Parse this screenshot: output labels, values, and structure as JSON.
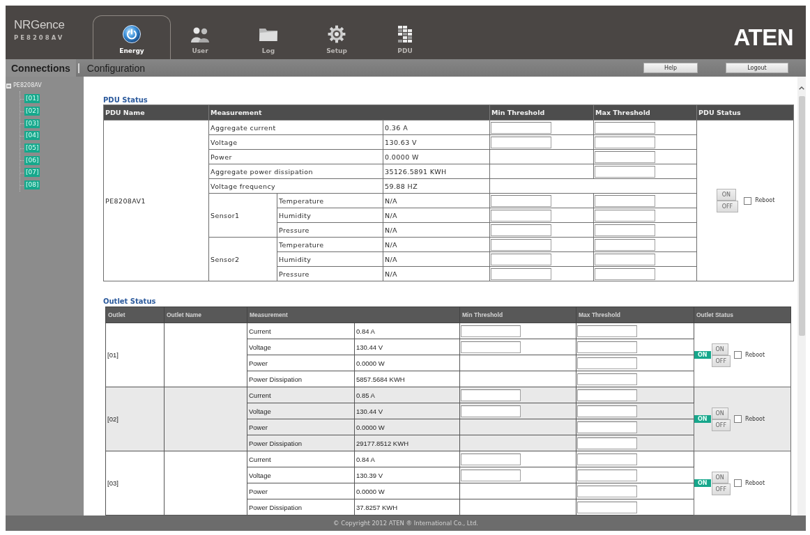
{
  "header": {
    "product_logo": {
      "brand": "NRGence",
      "model": "PE8208AV"
    },
    "tabs": [
      {
        "label": "Energy",
        "selected": true
      },
      {
        "label": "User",
        "selected": false
      },
      {
        "label": "Log",
        "selected": false
      },
      {
        "label": "Setup",
        "selected": false
      },
      {
        "label": "PDU",
        "selected": false
      }
    ],
    "vendor_logo": "ATEN"
  },
  "subnav": {
    "links": [
      {
        "label": "Connections",
        "selected": true
      },
      {
        "label": "Configuration",
        "selected": false
      }
    ],
    "buttons": [
      "Help",
      "Logout"
    ]
  },
  "sidebar": {
    "tree": {
      "label": "PE8208AV",
      "expanded": true,
      "children": [
        {
          "label": "[01]"
        },
        {
          "label": "[02]"
        },
        {
          "label": "[03]"
        },
        {
          "label": "[04]"
        },
        {
          "label": "[05]"
        },
        {
          "label": "[06]"
        },
        {
          "label": "[07]"
        },
        {
          "label": "[08]"
        }
      ]
    }
  },
  "pdu_status": {
    "title": "PDU Status",
    "columns": [
      "PDU Name",
      "Measurement",
      "Min Threshold",
      "Max Threshold",
      "PDU Status"
    ],
    "pdu_name": "PE8208AV1",
    "measurements": [
      {
        "label": "Aggregate current",
        "value": "0.36 A",
        "min_field": true,
        "max_field": true
      },
      {
        "label": "Voltage",
        "value": "130.63 V",
        "min_field": true,
        "max_field": true
      },
      {
        "label": "Power",
        "value": "0.0000 W",
        "min_field": false,
        "max_field": true
      },
      {
        "label": "Aggregate power dissipation",
        "value": "35126.5891 KWH",
        "min_field": false,
        "max_field": true
      },
      {
        "label": "Voltage frequency",
        "value": "59.88 HZ",
        "min_field": false,
        "max_field": false
      }
    ],
    "sensors": [
      {
        "name": "Sensor1",
        "readings": [
          {
            "label": "Temperature",
            "value": "N/A"
          },
          {
            "label": "Humidity",
            "value": "N/A"
          },
          {
            "label": "Pressure",
            "value": "N/A"
          }
        ]
      },
      {
        "name": "Sensor2",
        "readings": [
          {
            "label": "Temperature",
            "value": "N/A"
          },
          {
            "label": "Humidity",
            "value": "N/A"
          },
          {
            "label": "Pressure",
            "value": "N/A"
          }
        ]
      }
    ],
    "control": {
      "buttons": [
        "ON",
        "OFF"
      ],
      "reboot": {
        "label": "Reboot",
        "checked": false
      }
    }
  },
  "outlet_status": {
    "title": "Outlet Status",
    "columns": [
      "Outlet",
      "Outlet Name",
      "Measurement",
      "Min Threshold",
      "Max Threshold",
      "Outlet Status"
    ],
    "outlets": [
      {
        "outlet": "[01]",
        "state": "ON",
        "buttons": [
          "ON",
          "OFF"
        ],
        "reboot": {
          "label": "Reboot",
          "checked": false
        },
        "readings": [
          {
            "label": "Current",
            "value": "0.84 A",
            "min_field": true
          },
          {
            "label": "Voltage",
            "value": "130.44 V",
            "min_field": true
          },
          {
            "label": "Power",
            "value": "0.0000 W",
            "min_field": false
          },
          {
            "label": "Power Dissipation",
            "value": "5857.5684 KWH",
            "min_field": false
          }
        ]
      },
      {
        "outlet": "[02]",
        "state": "ON",
        "buttons": [
          "ON",
          "OFF"
        ],
        "reboot": {
          "label": "Reboot",
          "checked": false
        },
        "readings": [
          {
            "label": "Current",
            "value": "0.85 A",
            "min_field": true
          },
          {
            "label": "Voltage",
            "value": "130.44 V",
            "min_field": true
          },
          {
            "label": "Power",
            "value": "0.0000 W",
            "min_field": false
          },
          {
            "label": "Power Dissipation",
            "value": "29177.8512 KWH",
            "min_field": false
          }
        ]
      },
      {
        "outlet": "[03]",
        "state": "ON",
        "buttons": [
          "ON",
          "OFF"
        ],
        "reboot": {
          "label": "Reboot",
          "checked": false
        },
        "readings": [
          {
            "label": "Current",
            "value": "0.84 A",
            "min_field": true
          },
          {
            "label": "Voltage",
            "value": "130.39 V",
            "min_field": true
          },
          {
            "label": "Power",
            "value": "0.0000 W",
            "min_field": false
          },
          {
            "label": "Power Dissipation",
            "value": "37.8257 KWH",
            "min_field": false
          }
        ]
      }
    ]
  },
  "footer": {
    "copyright": "© Copyright 2012 ATEN ® International Co., Ltd."
  }
}
